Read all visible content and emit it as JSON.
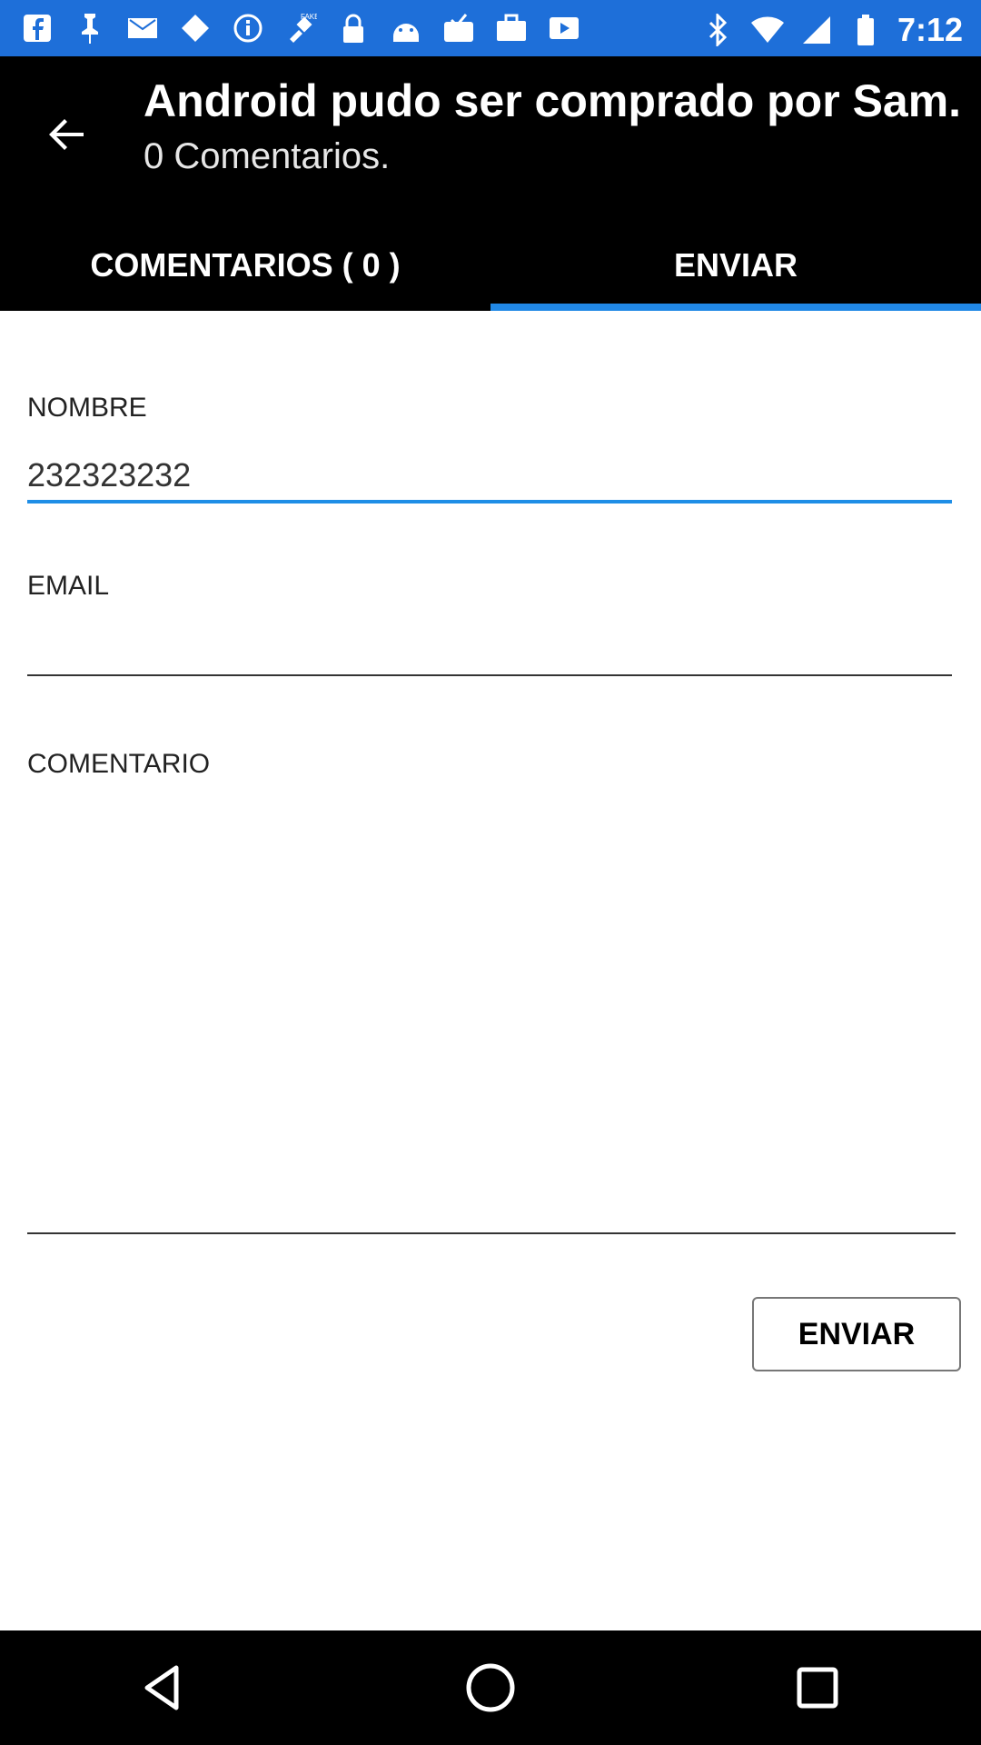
{
  "status_bar": {
    "time": "7:12",
    "icons_left": [
      "facebook-icon",
      "pin-icon",
      "mail-icon",
      "diamond-icon",
      "info-icon",
      "fake-gps-icon",
      "lock-icon",
      "android-icon",
      "inbox-icon",
      "briefcase-icon",
      "video-icon"
    ],
    "icons_right": [
      "bluetooth-icon",
      "wifi-icon",
      "signal-icon",
      "battery-icon"
    ]
  },
  "header": {
    "title": "Android pudo ser comprado por Sam...",
    "subtitle": "0 Comentarios."
  },
  "tabs": [
    {
      "label": "COMENTARIOS ( 0 )"
    },
    {
      "label": "ENVIAR"
    }
  ],
  "form": {
    "name_label": "NOMBRE",
    "name_value": "232323232",
    "email_label": "EMAIL",
    "email_value": "",
    "comment_label": "COMENTARIO",
    "comment_value": "",
    "send_label": "ENVIAR"
  },
  "colors": {
    "status_bar": "#1e6fd9",
    "accent": "#2188e6"
  }
}
